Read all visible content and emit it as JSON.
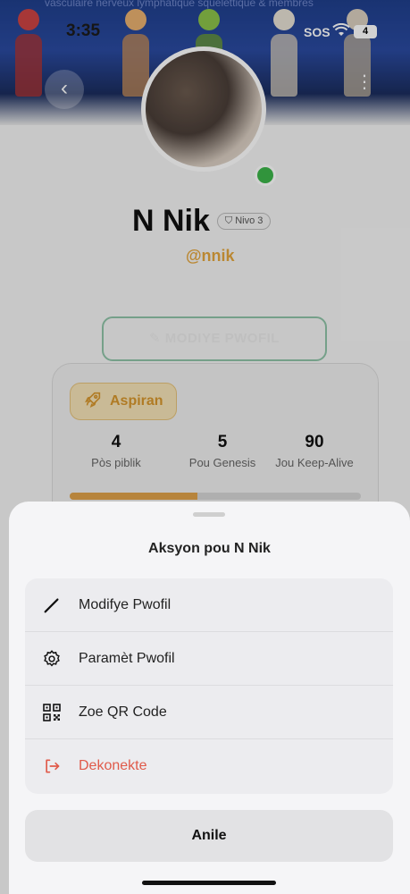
{
  "status_bar": {
    "time": "3:35",
    "sos": "SOS",
    "battery": "4"
  },
  "banner": {
    "caption": "vasculaire   nerveux   lymphatique   squelettique   & membres"
  },
  "profile": {
    "name": "N Nik",
    "level": "Nivo 3",
    "handle": "@nnik",
    "edit_button": "MODIYE PWOFIL",
    "rank": "Aspiran",
    "stats": [
      {
        "value": "4",
        "label": "Pòs piblik"
      },
      {
        "value": "5",
        "label": "Pou Genesis"
      },
      {
        "value": "90",
        "label": "Jou Keep-Alive"
      }
    ],
    "progress": 0.44
  },
  "sheet": {
    "title": "Aksyon pou N Nik",
    "actions": [
      {
        "label": "Modifye Pwofil",
        "icon": "pencil-icon"
      },
      {
        "label": "Paramèt Pwofil",
        "icon": "gear-icon"
      },
      {
        "label": "Zoe QR Code",
        "icon": "qr-code-icon"
      },
      {
        "label": "Dekonekte",
        "icon": "logout-icon",
        "danger": true
      }
    ],
    "cancel": "Anile"
  },
  "colors": {
    "accent_gold": "#e3a53c",
    "danger": "#e05a4a",
    "online": "#3cb54a"
  }
}
